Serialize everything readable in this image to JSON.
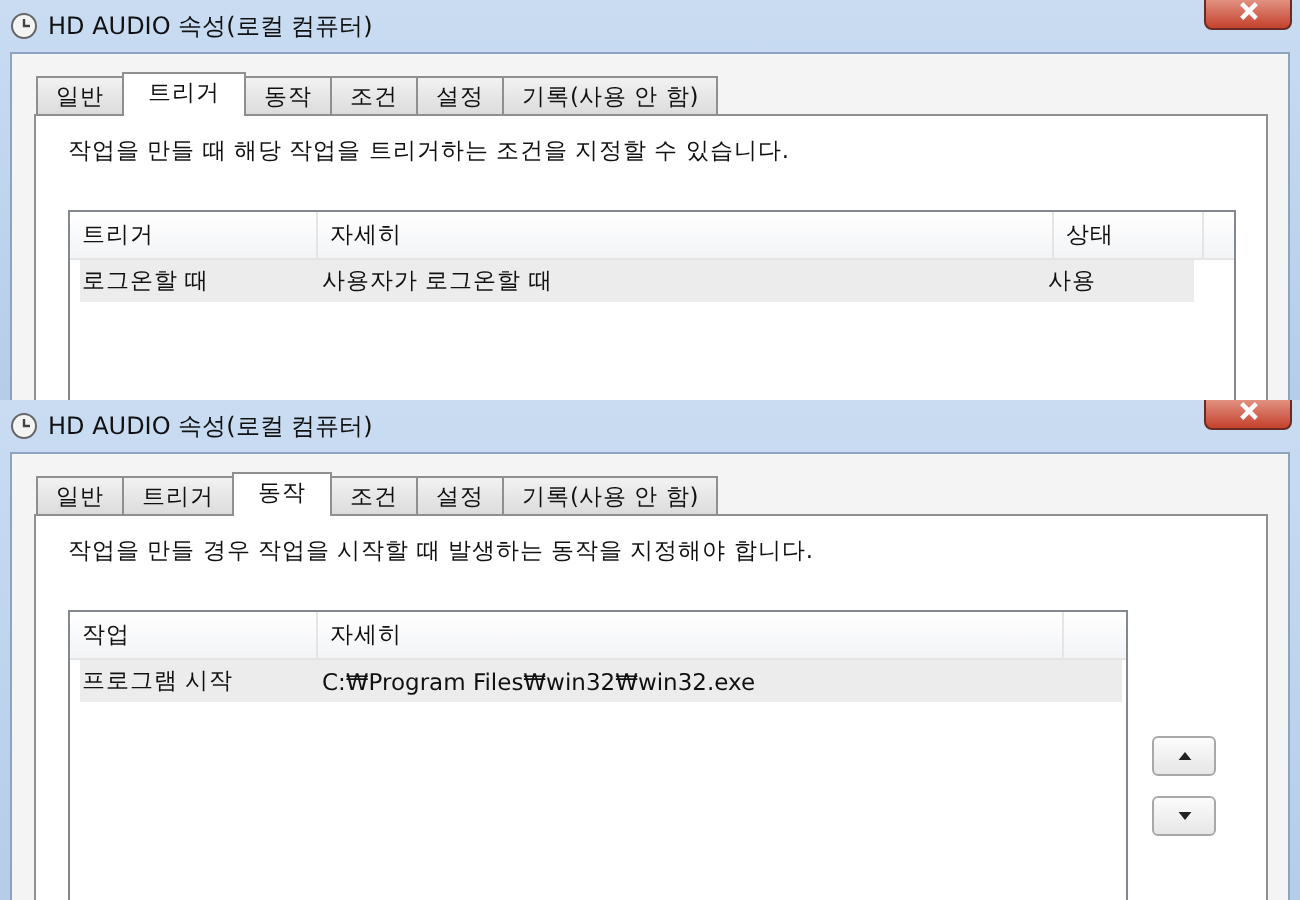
{
  "windows": [
    {
      "title": "HD AUDIO 속성(로컬 컴퓨터)",
      "tabs": [
        {
          "label": "일반",
          "selected": false
        },
        {
          "label": "트리거",
          "selected": true
        },
        {
          "label": "동작",
          "selected": false
        },
        {
          "label": "조건",
          "selected": false
        },
        {
          "label": "설정",
          "selected": false
        },
        {
          "label": "기록(사용 안 함)",
          "selected": false
        }
      ],
      "description": "작업을 만들 때 해당 작업을 트리거하는 조건을 지정할 수 있습니다.",
      "table": {
        "columns": [
          "트리거",
          "자세히",
          "상태"
        ],
        "rows": [
          {
            "cells": [
              "로그온할 때",
              "사용자가 로그온할 때",
              "사용"
            ],
            "selected": true
          }
        ]
      }
    },
    {
      "title": "HD AUDIO 속성(로컬 컴퓨터)",
      "tabs": [
        {
          "label": "일반",
          "selected": false
        },
        {
          "label": "트리거",
          "selected": false
        },
        {
          "label": "동작",
          "selected": true
        },
        {
          "label": "조건",
          "selected": false
        },
        {
          "label": "설정",
          "selected": false
        },
        {
          "label": "기록(사용 안 함)",
          "selected": false
        }
      ],
      "description": "작업을 만들 경우 작업을 시작할 때 발생하는 동작을 지정해야 합니다.",
      "table": {
        "columns": [
          "작업",
          "자세히"
        ],
        "rows": [
          {
            "cells": [
              "프로그램 시작",
              "C:₩Program Files₩win32₩win32.exe"
            ],
            "selected": true
          }
        ]
      },
      "move_buttons": [
        {
          "kind": "up"
        },
        {
          "kind": "down"
        }
      ]
    }
  ]
}
